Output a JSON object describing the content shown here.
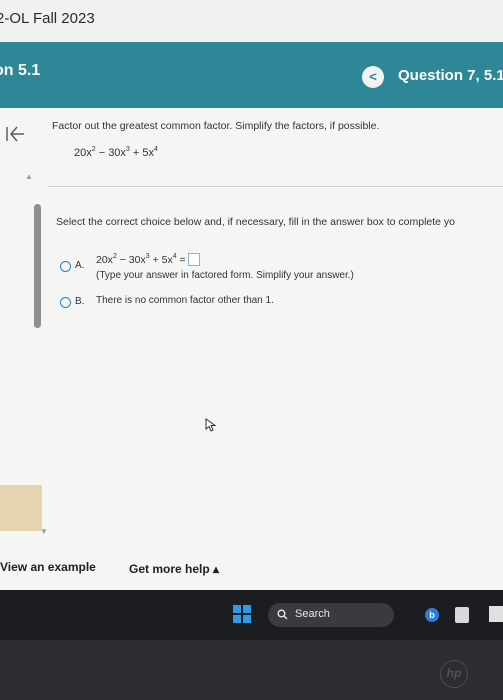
{
  "course": {
    "title": "2-OL Fall 2023"
  },
  "header": {
    "section_title": "on 5.1",
    "prev_label": "<",
    "question_label": "Question 7, 5.1"
  },
  "problem": {
    "prompt": "Factor out the greatest common factor. Simplify the factors, if possible.",
    "expression": {
      "t1": "20x",
      "e1": "2",
      "t2": " − 30x",
      "e2": "3",
      "t3": " + 5x",
      "e3": "4"
    }
  },
  "choices": {
    "instruction": "Select the correct choice below and, if necessary, fill in the answer box to complete yo",
    "a": {
      "letter": "A.",
      "expression": {
        "t1": "20x",
        "e1": "2",
        "t2": " − 30x",
        "e2": "3",
        "t3": " + 5x",
        "e3": "4",
        "eq": " ="
      },
      "note": "(Type your answer in factored form. Simplify your answer.)"
    },
    "b": {
      "letter": "B.",
      "text": "There is no common factor other than 1."
    }
  },
  "footer": {
    "view_example": "View an example",
    "more_help": "Get more help ▴"
  },
  "taskbar": {
    "search_label": "Search",
    "browser_letter": "b"
  },
  "bezel": {
    "logo": "hp"
  },
  "colors": {
    "header_teal": "#2e8796",
    "radio_blue": "#2b7fbd",
    "taskbar": "#1c1d20"
  }
}
